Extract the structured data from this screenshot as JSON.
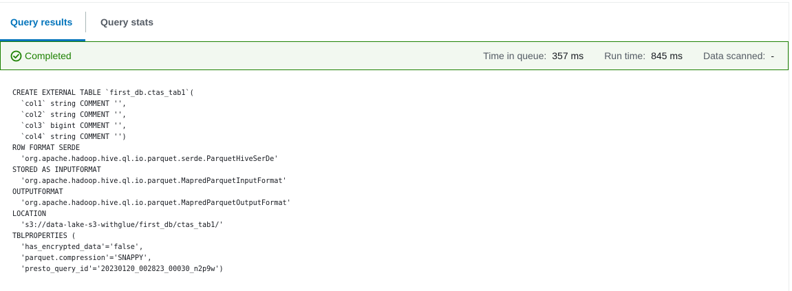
{
  "tabs": [
    {
      "label": "Query results",
      "active": true
    },
    {
      "label": "Query stats",
      "active": false
    }
  ],
  "status": {
    "icon": "check-circle-icon",
    "text": "Completed",
    "color": "#1d8102",
    "metrics": {
      "time_in_queue_label": "Time in queue:",
      "time_in_queue_value": "357 ms",
      "run_time_label": "Run time:",
      "run_time_value": "845 ms",
      "data_scanned_label": "Data scanned:",
      "data_scanned_value": "-"
    }
  },
  "accent_color": "#0073bb",
  "result_lines": [
    "CREATE EXTERNAL TABLE `first_db.ctas_tab1`(",
    "  `col1` string COMMENT '',",
    "  `col2` string COMMENT '',",
    "  `col3` bigint COMMENT '',",
    "  `col4` string COMMENT '')",
    "ROW FORMAT SERDE",
    "  'org.apache.hadoop.hive.ql.io.parquet.serde.ParquetHiveSerDe'",
    "STORED AS INPUTFORMAT",
    "  'org.apache.hadoop.hive.ql.io.parquet.MapredParquetInputFormat'",
    "OUTPUTFORMAT",
    "  'org.apache.hadoop.hive.ql.io.parquet.MapredParquetOutputFormat'",
    "LOCATION",
    "  's3://data-lake-s3-withglue/first_db/ctas_tab1/'",
    "TBLPROPERTIES (",
    "  'has_encrypted_data'='false',",
    "  'parquet.compression'='SNAPPY',",
    "  'presto_query_id'='20230120_002823_00030_n2p9w')"
  ]
}
